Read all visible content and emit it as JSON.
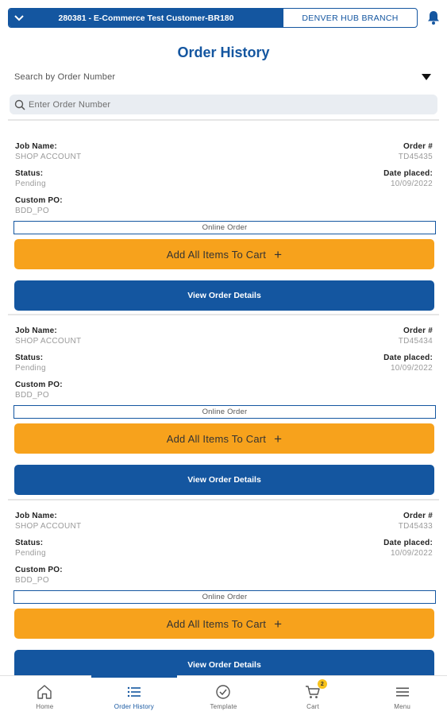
{
  "header": {
    "account_label": "280381 - E-Commerce Test Customer-BR180",
    "branch_label": "DENVER HUB BRANCH"
  },
  "page_title": "Order History",
  "search": {
    "mode_label": "Search by Order Number",
    "placeholder": "Enter Order Number",
    "value": ""
  },
  "field_labels": {
    "job_name": "Job Name:",
    "order_number": "Order #",
    "status": "Status:",
    "date_placed": "Date placed:",
    "custom_po": "Custom PO:"
  },
  "buttons": {
    "add_all": "Add All Items To Cart",
    "add_icon": "+",
    "view_details": "View Order Details"
  },
  "orders": [
    {
      "job_name": "SHOP ACCOUNT",
      "order_number": "TD45435",
      "status": "Pending",
      "date_placed": "10/09/2022",
      "custom_po": "BDD_PO",
      "order_type": "Online Order"
    },
    {
      "job_name": "SHOP ACCOUNT",
      "order_number": "TD45434",
      "status": "Pending",
      "date_placed": "10/09/2022",
      "custom_po": "BDD_PO",
      "order_type": "Online Order"
    },
    {
      "job_name": "SHOP ACCOUNT",
      "order_number": "TD45433",
      "status": "Pending",
      "date_placed": "10/09/2022",
      "custom_po": "BDD_PO",
      "order_type": "Online Order"
    }
  ],
  "bottom_nav": {
    "items": [
      {
        "label": "Home",
        "icon": "home-icon"
      },
      {
        "label": "Order History",
        "icon": "list-icon",
        "active": true
      },
      {
        "label": "Template",
        "icon": "check-circle-icon"
      },
      {
        "label": "Cart",
        "icon": "cart-icon",
        "badge": "2"
      },
      {
        "label": "Menu",
        "icon": "hamburger-menu-icon"
      }
    ]
  },
  "colors": {
    "brand_blue": "#1456a0",
    "accent_orange": "#f7a21c",
    "badge_yellow": "#f7c21c"
  }
}
